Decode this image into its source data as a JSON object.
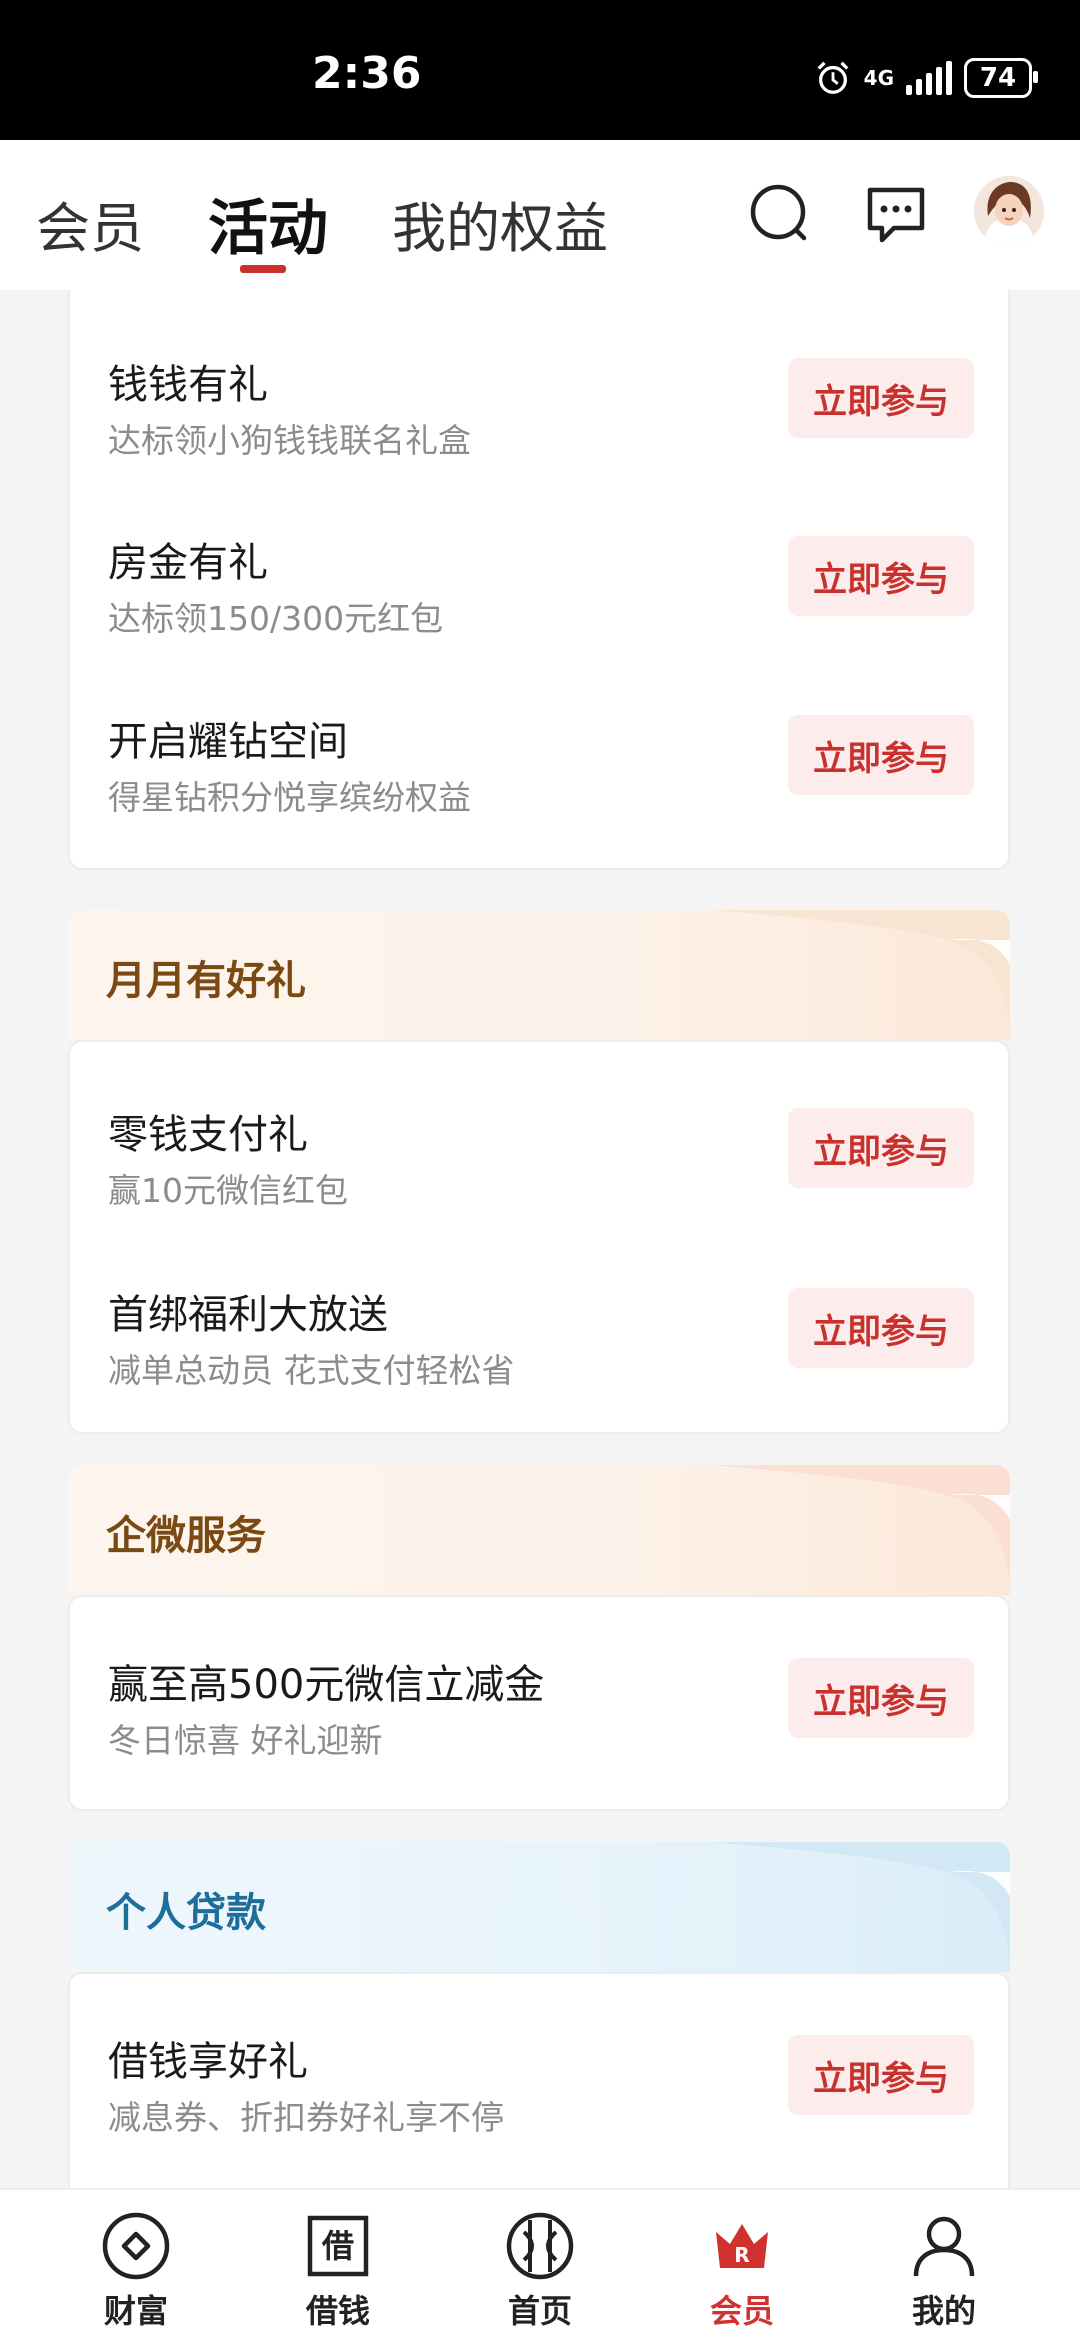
{
  "status_bar": {
    "time": "2:36",
    "network": "4G",
    "battery": "74"
  },
  "header": {
    "tabs": [
      {
        "label": "会员"
      },
      {
        "label": "活动"
      },
      {
        "label": "我的权益"
      }
    ],
    "active_tab": "活动"
  },
  "sections": [
    {
      "title": "",
      "items": [
        {
          "title": "钱钱有礼",
          "subtitle": "达标领小狗钱钱联名礼盒",
          "button": "立即参与"
        },
        {
          "title": "房金有礼",
          "subtitle": "达标领150/300元红包",
          "button": "立即参与"
        },
        {
          "title": "开启耀钻空间",
          "subtitle": "得星钻积分悦享缤纷权益",
          "button": "立即参与"
        }
      ]
    },
    {
      "title": "月月有好礼",
      "items": [
        {
          "title": "零钱支付礼",
          "subtitle": "赢10元微信红包",
          "button": "立即参与"
        },
        {
          "title": "首绑福利大放送",
          "subtitle": "减单总动员 花式支付轻松省",
          "button": "立即参与"
        }
      ]
    },
    {
      "title": "企微服务",
      "items": [
        {
          "title": "赢至高500元微信立减金",
          "subtitle": "冬日惊喜 好礼迎新",
          "button": "立即参与"
        }
      ]
    },
    {
      "title": "个人贷款",
      "items": [
        {
          "title": "借钱享好礼",
          "subtitle": "减息券、折扣券好礼享不停",
          "button": "立即参与"
        }
      ]
    }
  ],
  "bottom_nav": {
    "items": [
      {
        "label": "财富",
        "icon": "wealth-icon"
      },
      {
        "label": "借钱",
        "icon": "borrow-icon",
        "glyph": "借"
      },
      {
        "label": "首页",
        "icon": "home-icon"
      },
      {
        "label": "会员",
        "icon": "member-icon",
        "glyph": "R"
      },
      {
        "label": "我的",
        "icon": "profile-icon"
      }
    ],
    "active": "会员",
    "active_color": "#d1322e"
  },
  "colors": {
    "accent": "#c8322e",
    "button_bg": "#fdecec",
    "warm_title": "#7a4a12",
    "blue_title": "#1d6e9a"
  }
}
